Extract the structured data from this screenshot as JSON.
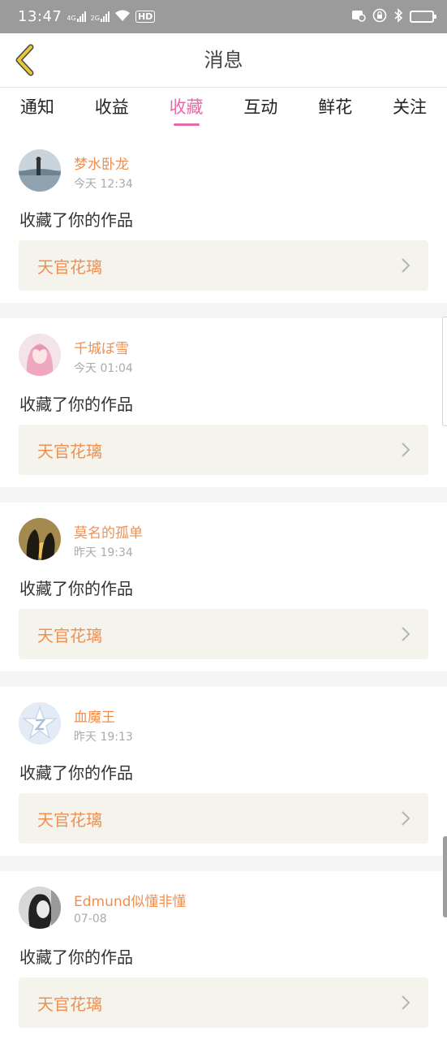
{
  "status_bar": {
    "time": "13:47",
    "net_4g": "4G",
    "net_2g": "2G",
    "hd": "HD"
  },
  "nav": {
    "title": "消息"
  },
  "tabs": [
    {
      "label": "通知",
      "active": false
    },
    {
      "label": "收益",
      "active": false
    },
    {
      "label": "收藏",
      "active": true
    },
    {
      "label": "互动",
      "active": false
    },
    {
      "label": "鲜花",
      "active": false
    },
    {
      "label": "关注",
      "active": false
    }
  ],
  "items": [
    {
      "user": "梦水卧龙",
      "time": "今天 12:34",
      "action": "收藏了你的作品",
      "work": "天官花璃"
    },
    {
      "user": "千城ぼ雪",
      "time": "今天 01:04",
      "action": "收藏了你的作品",
      "work": "天官花璃"
    },
    {
      "user": "莫名的孤单",
      "time": "昨天 19:34",
      "action": "收藏了你的作品",
      "work": "天官花璃"
    },
    {
      "user": "血魔王",
      "time": "昨天 19:13",
      "action": "收藏了你的作品",
      "work": "天官花璃"
    },
    {
      "user": "Edmund似懂非懂",
      "time": "07-08",
      "action": "收藏了你的作品",
      "work": "天官花璃"
    }
  ],
  "colors": {
    "accent_pink": "#e86aa8",
    "username_orange": "#f08f50",
    "back_arrow": "#e6c93a",
    "status_bar_bg": "#9b9b9b"
  }
}
